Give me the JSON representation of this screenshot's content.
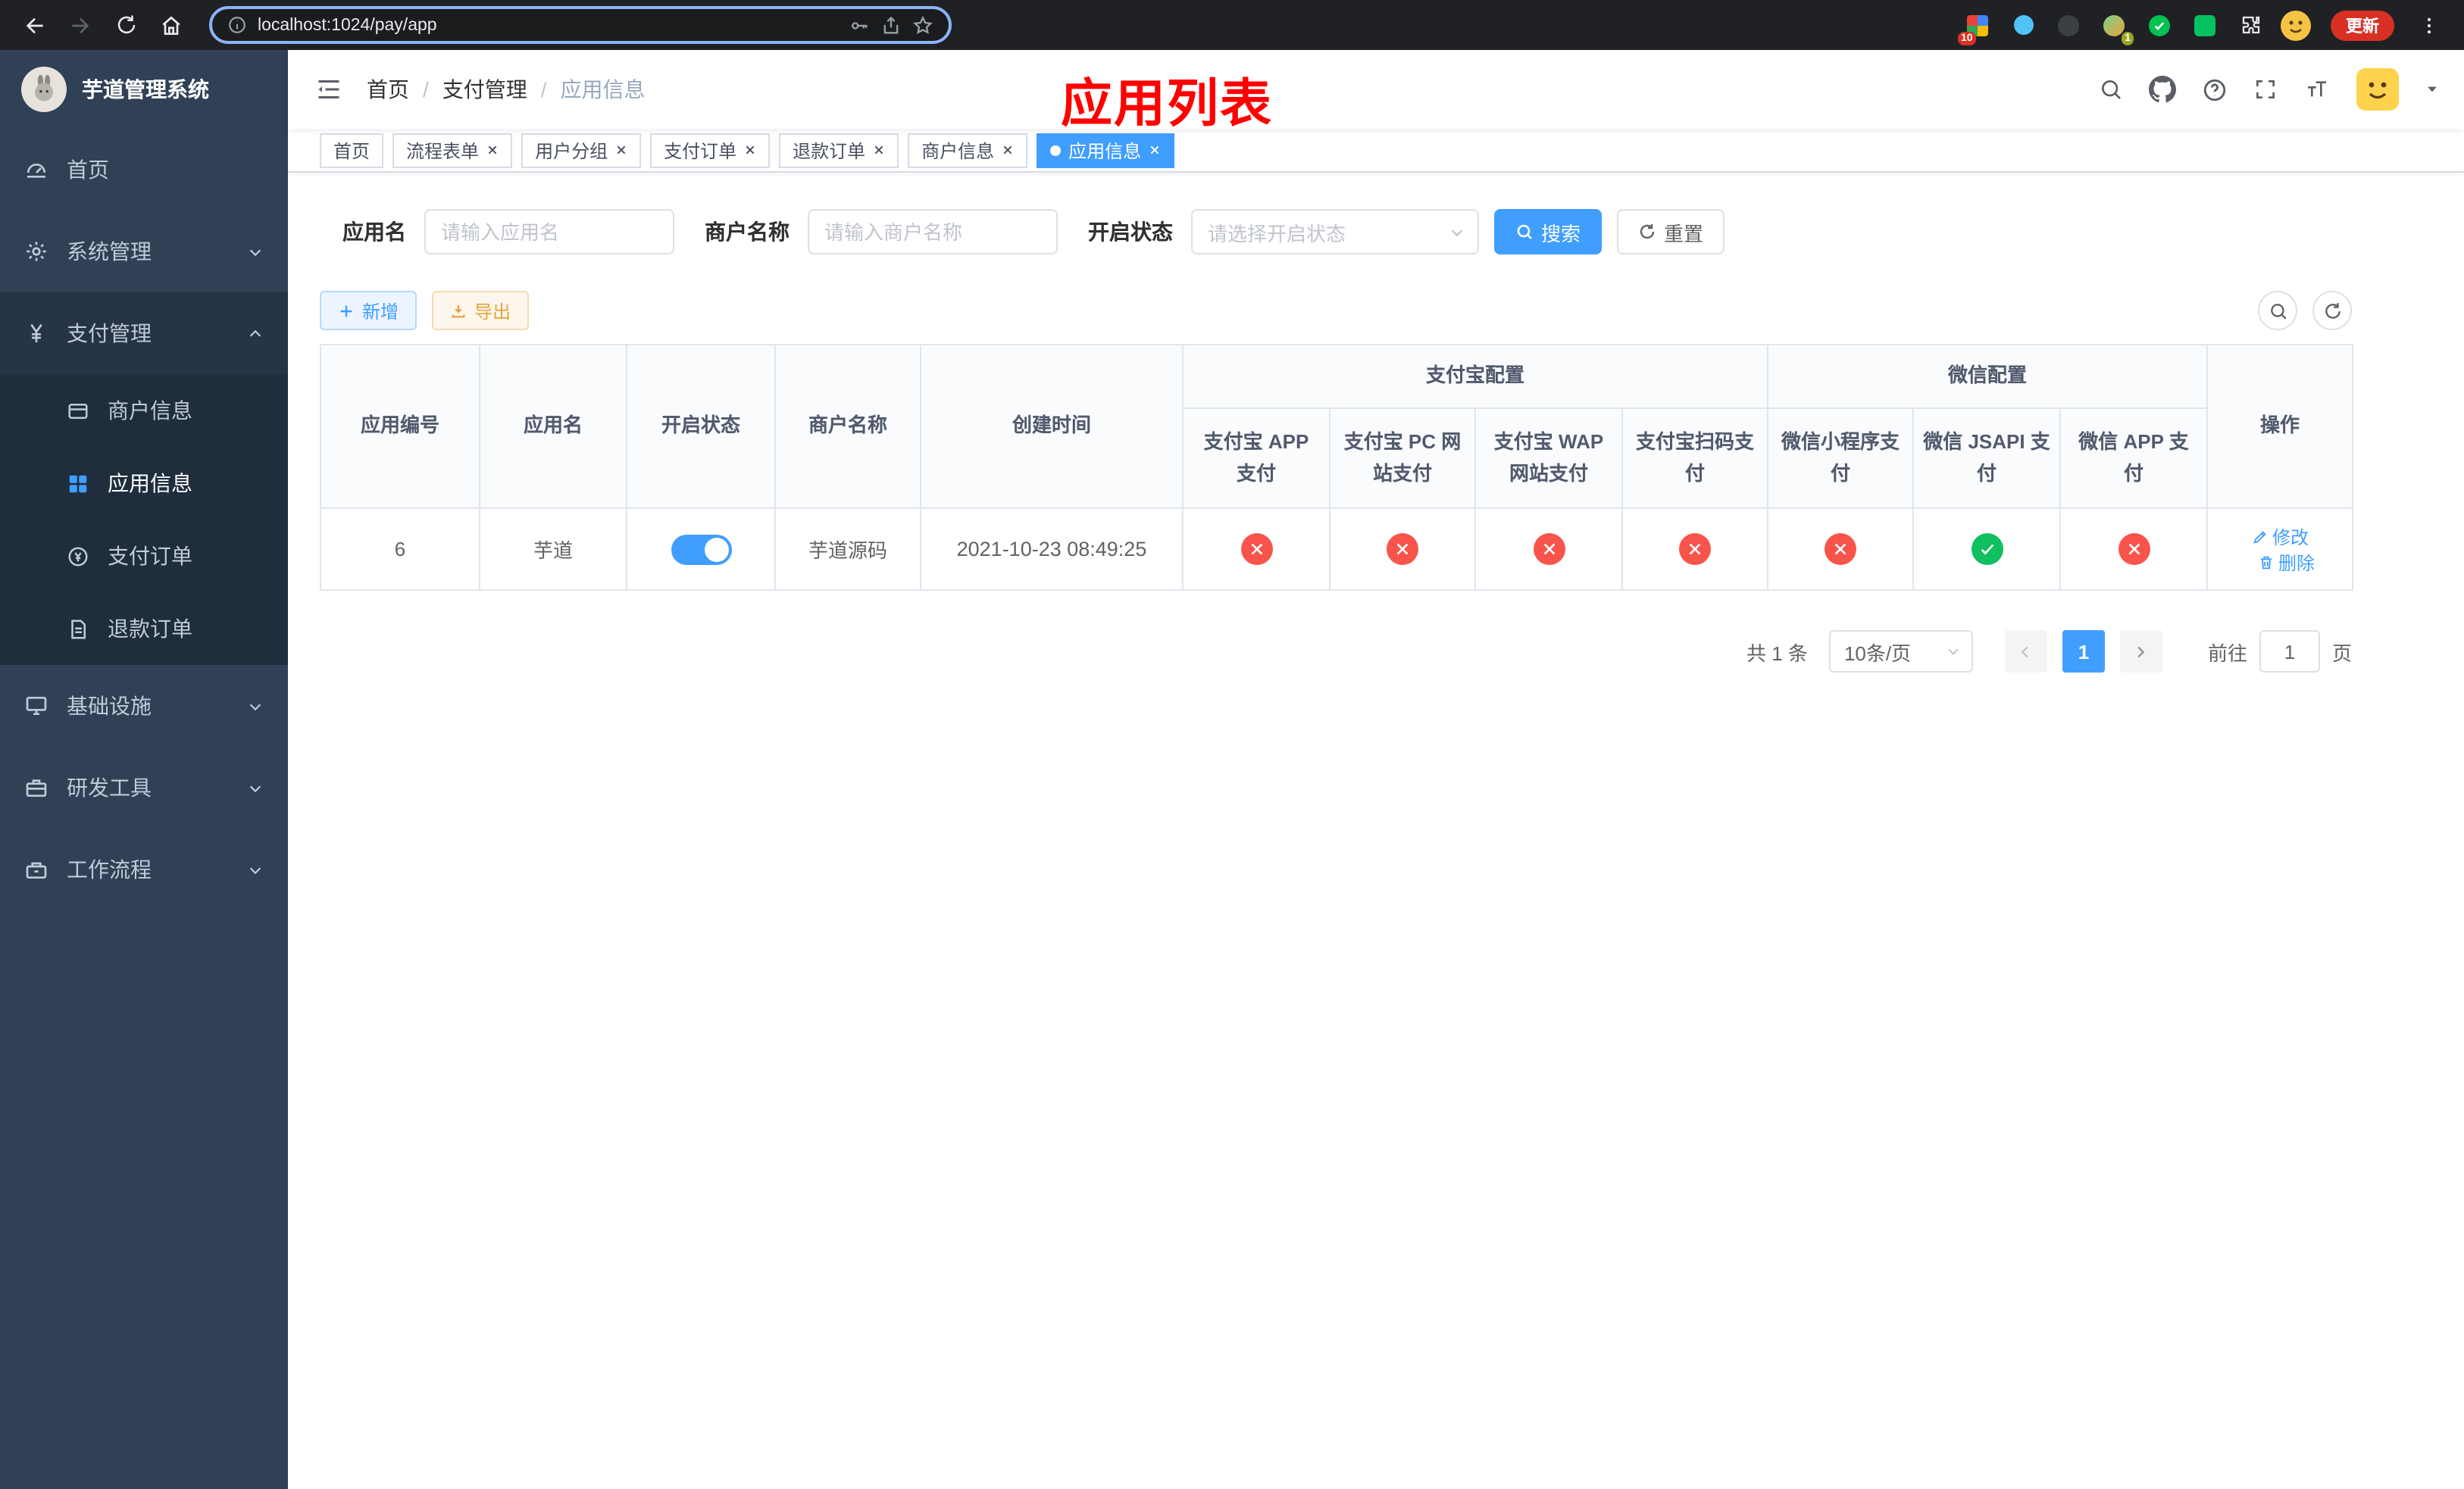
{
  "browser": {
    "url": "localhost:1024/pay/app",
    "update_label": "更新",
    "ext_badge_a": "10",
    "ext_badge_b": "1"
  },
  "overlay": {
    "title": "应用列表"
  },
  "sidebar": {
    "title": "芋道管理系统",
    "items": {
      "home": "首页",
      "system": "系统管理",
      "payment": "支付管理",
      "merchant_info": "商户信息",
      "app_info": "应用信息",
      "pay_order": "支付订单",
      "refund_order": "退款订单",
      "infrastructure": "基础设施",
      "dev_tools": "研发工具",
      "workflow": "工作流程"
    }
  },
  "navbar": {
    "breadcrumb": {
      "items": [
        "首页",
        "支付管理",
        "应用信息"
      ],
      "separator": "/"
    }
  },
  "tabs": [
    {
      "label": "首页",
      "closable": false,
      "active": false
    },
    {
      "label": "流程表单",
      "closable": true,
      "active": false
    },
    {
      "label": "用户分组",
      "closable": true,
      "active": false
    },
    {
      "label": "支付订单",
      "closable": true,
      "active": false
    },
    {
      "label": "退款订单",
      "closable": true,
      "active": false
    },
    {
      "label": "商户信息",
      "closable": true,
      "active": false
    },
    {
      "label": "应用信息",
      "closable": true,
      "active": true
    }
  ],
  "filters": {
    "app_name_label": "应用名",
    "app_name_placeholder": "请输入应用名",
    "merchant_label": "商户名称",
    "merchant_placeholder": "请输入商户名称",
    "status_label": "开启状态",
    "status_placeholder": "请选择开启状态",
    "search": "搜索",
    "reset": "重置"
  },
  "toolbar": {
    "add": "新增",
    "export": "导出"
  },
  "table": {
    "headers": {
      "app_id": "应用编号",
      "app_name": "应用名",
      "status": "开启状态",
      "merchant": "商户名称",
      "created": "创建时间",
      "alipay_group": "支付宝配置",
      "alipay_app": "支付宝 APP 支付",
      "alipay_pc": "支付宝 PC 网站支付",
      "alipay_wap": "支付宝 WAP 网站支付",
      "alipay_scan": "支付宝扫码支付",
      "wechat_group": "微信配置",
      "wechat_mini": "微信小程序支付",
      "wechat_jsapi": "微信 JSAPI 支付",
      "wechat_app": "微信 APP 支付",
      "actions": "操作"
    },
    "actions": {
      "edit": "修改",
      "delete": "删除"
    },
    "rows": [
      {
        "app_id": "6",
        "app_name": "芋道",
        "status_on": true,
        "merchant": "芋道源码",
        "created": "2021-10-23 08:49:25",
        "channels": {
          "alipay_app": false,
          "alipay_pc": false,
          "alipay_wap": false,
          "alipay_scan": false,
          "wechat_mini": false,
          "wechat_jsapi": true,
          "wechat_app": false
        }
      }
    ]
  },
  "pagination": {
    "total": "共 1 条",
    "page_size": "10条/页",
    "page": "1",
    "goto_label": "前往",
    "goto_value": "1",
    "goto_suffix": "页"
  }
}
